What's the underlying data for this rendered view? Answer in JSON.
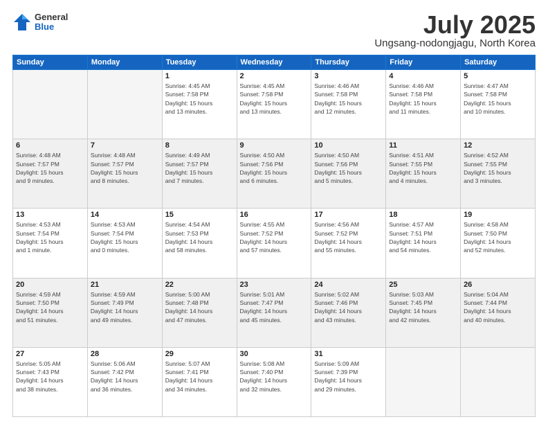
{
  "header": {
    "logo_line1": "General",
    "logo_line2": "Blue",
    "title": "July 2025",
    "subtitle": "Ungsang-nodongjagu, North Korea"
  },
  "weekdays": [
    "Sunday",
    "Monday",
    "Tuesday",
    "Wednesday",
    "Thursday",
    "Friday",
    "Saturday"
  ],
  "weeks": [
    [
      {
        "day": "",
        "info": ""
      },
      {
        "day": "",
        "info": ""
      },
      {
        "day": "1",
        "info": "Sunrise: 4:45 AM\nSunset: 7:58 PM\nDaylight: 15 hours\nand 13 minutes."
      },
      {
        "day": "2",
        "info": "Sunrise: 4:45 AM\nSunset: 7:58 PM\nDaylight: 15 hours\nand 13 minutes."
      },
      {
        "day": "3",
        "info": "Sunrise: 4:46 AM\nSunset: 7:58 PM\nDaylight: 15 hours\nand 12 minutes."
      },
      {
        "day": "4",
        "info": "Sunrise: 4:46 AM\nSunset: 7:58 PM\nDaylight: 15 hours\nand 11 minutes."
      },
      {
        "day": "5",
        "info": "Sunrise: 4:47 AM\nSunset: 7:58 PM\nDaylight: 15 hours\nand 10 minutes."
      }
    ],
    [
      {
        "day": "6",
        "info": "Sunrise: 4:48 AM\nSunset: 7:57 PM\nDaylight: 15 hours\nand 9 minutes."
      },
      {
        "day": "7",
        "info": "Sunrise: 4:48 AM\nSunset: 7:57 PM\nDaylight: 15 hours\nand 8 minutes."
      },
      {
        "day": "8",
        "info": "Sunrise: 4:49 AM\nSunset: 7:57 PM\nDaylight: 15 hours\nand 7 minutes."
      },
      {
        "day": "9",
        "info": "Sunrise: 4:50 AM\nSunset: 7:56 PM\nDaylight: 15 hours\nand 6 minutes."
      },
      {
        "day": "10",
        "info": "Sunrise: 4:50 AM\nSunset: 7:56 PM\nDaylight: 15 hours\nand 5 minutes."
      },
      {
        "day": "11",
        "info": "Sunrise: 4:51 AM\nSunset: 7:55 PM\nDaylight: 15 hours\nand 4 minutes."
      },
      {
        "day": "12",
        "info": "Sunrise: 4:52 AM\nSunset: 7:55 PM\nDaylight: 15 hours\nand 3 minutes."
      }
    ],
    [
      {
        "day": "13",
        "info": "Sunrise: 4:53 AM\nSunset: 7:54 PM\nDaylight: 15 hours\nand 1 minute."
      },
      {
        "day": "14",
        "info": "Sunrise: 4:53 AM\nSunset: 7:54 PM\nDaylight: 15 hours\nand 0 minutes."
      },
      {
        "day": "15",
        "info": "Sunrise: 4:54 AM\nSunset: 7:53 PM\nDaylight: 14 hours\nand 58 minutes."
      },
      {
        "day": "16",
        "info": "Sunrise: 4:55 AM\nSunset: 7:52 PM\nDaylight: 14 hours\nand 57 minutes."
      },
      {
        "day": "17",
        "info": "Sunrise: 4:56 AM\nSunset: 7:52 PM\nDaylight: 14 hours\nand 55 minutes."
      },
      {
        "day": "18",
        "info": "Sunrise: 4:57 AM\nSunset: 7:51 PM\nDaylight: 14 hours\nand 54 minutes."
      },
      {
        "day": "19",
        "info": "Sunrise: 4:58 AM\nSunset: 7:50 PM\nDaylight: 14 hours\nand 52 minutes."
      }
    ],
    [
      {
        "day": "20",
        "info": "Sunrise: 4:59 AM\nSunset: 7:50 PM\nDaylight: 14 hours\nand 51 minutes."
      },
      {
        "day": "21",
        "info": "Sunrise: 4:59 AM\nSunset: 7:49 PM\nDaylight: 14 hours\nand 49 minutes."
      },
      {
        "day": "22",
        "info": "Sunrise: 5:00 AM\nSunset: 7:48 PM\nDaylight: 14 hours\nand 47 minutes."
      },
      {
        "day": "23",
        "info": "Sunrise: 5:01 AM\nSunset: 7:47 PM\nDaylight: 14 hours\nand 45 minutes."
      },
      {
        "day": "24",
        "info": "Sunrise: 5:02 AM\nSunset: 7:46 PM\nDaylight: 14 hours\nand 43 minutes."
      },
      {
        "day": "25",
        "info": "Sunrise: 5:03 AM\nSunset: 7:45 PM\nDaylight: 14 hours\nand 42 minutes."
      },
      {
        "day": "26",
        "info": "Sunrise: 5:04 AM\nSunset: 7:44 PM\nDaylight: 14 hours\nand 40 minutes."
      }
    ],
    [
      {
        "day": "27",
        "info": "Sunrise: 5:05 AM\nSunset: 7:43 PM\nDaylight: 14 hours\nand 38 minutes."
      },
      {
        "day": "28",
        "info": "Sunrise: 5:06 AM\nSunset: 7:42 PM\nDaylight: 14 hours\nand 36 minutes."
      },
      {
        "day": "29",
        "info": "Sunrise: 5:07 AM\nSunset: 7:41 PM\nDaylight: 14 hours\nand 34 minutes."
      },
      {
        "day": "30",
        "info": "Sunrise: 5:08 AM\nSunset: 7:40 PM\nDaylight: 14 hours\nand 32 minutes."
      },
      {
        "day": "31",
        "info": "Sunrise: 5:09 AM\nSunset: 7:39 PM\nDaylight: 14 hours\nand 29 minutes."
      },
      {
        "day": "",
        "info": ""
      },
      {
        "day": "",
        "info": ""
      }
    ]
  ]
}
